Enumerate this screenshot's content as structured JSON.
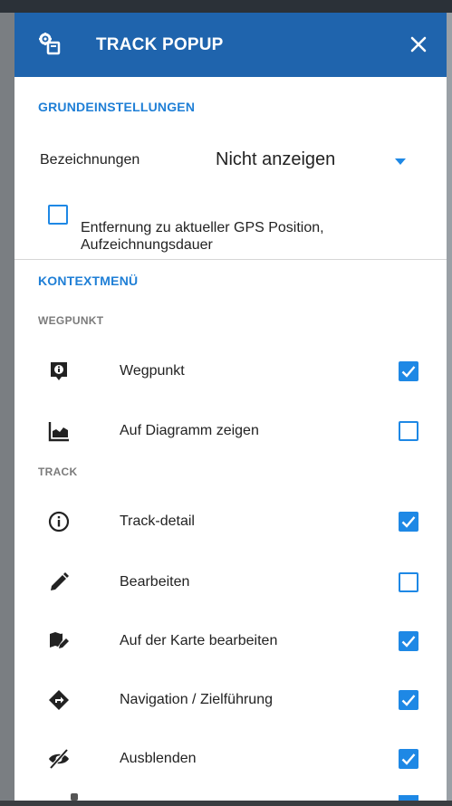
{
  "header": {
    "title": "TRACK POPUP",
    "color": "#1f64ad"
  },
  "basic": {
    "title": "GRUNDEINSTELLUNGEN",
    "labels_label": "Bezeichnungen",
    "labels_value": "Nicht anzeigen",
    "gps_checkbox_label": "Entfernung zu aktueller GPS Position, Aufzeichnungsdauer",
    "gps_checkbox_checked": false
  },
  "context_menu": {
    "title": "KONTEXTMENÜ",
    "waypoint_header": "WEGPUNKT",
    "track_header": "TRACK",
    "waypoint_items": [
      {
        "label": "Wegpunkt",
        "icon": "waypoint-info-icon",
        "checked": true
      },
      {
        "label": "Auf Diagramm zeigen",
        "icon": "chart-icon",
        "checked": false
      }
    ],
    "track_items": [
      {
        "label": "Track-detail",
        "icon": "info-circle-icon",
        "checked": true
      },
      {
        "label": "Bearbeiten",
        "icon": "pencil-icon",
        "checked": false
      },
      {
        "label": "Auf der Karte bearbeiten",
        "icon": "map-edit-icon",
        "checked": true
      },
      {
        "label": "Navigation / Zielführung",
        "icon": "navigation-icon",
        "checked": true
      },
      {
        "label": "Ausblenden",
        "icon": "eye-off-icon",
        "checked": true
      }
    ]
  },
  "accent_color": "#1e88e5"
}
